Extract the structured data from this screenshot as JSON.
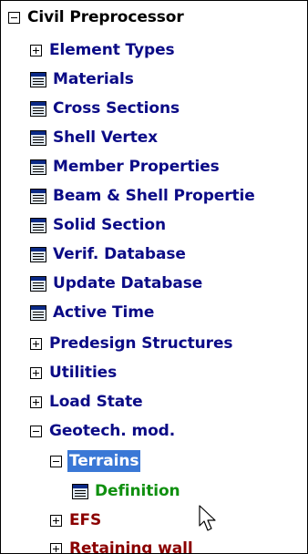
{
  "tree": {
    "root": {
      "label": "Civil Preprocessor",
      "state": "expanded"
    },
    "items": [
      {
        "label": "Element Types",
        "kind": "folder",
        "state": "collapsed",
        "color": "#0b0b86"
      },
      {
        "label": "Materials",
        "kind": "form",
        "color": "#0b0b86"
      },
      {
        "label": "Cross Sections",
        "kind": "form",
        "color": "#0b0b86"
      },
      {
        "label": "Shell Vertex",
        "kind": "form",
        "color": "#0b0b86"
      },
      {
        "label": "Member Properties",
        "kind": "form",
        "color": "#0b0b86"
      },
      {
        "label": "Beam & Shell Propertie",
        "kind": "form",
        "color": "#0b0b86"
      },
      {
        "label": "Solid Section",
        "kind": "form",
        "color": "#0b0b86"
      },
      {
        "label": "Verif. Database",
        "kind": "form",
        "color": "#0b0b86"
      },
      {
        "label": "Update Database",
        "kind": "form",
        "color": "#0b0b86"
      },
      {
        "label": "Active Time",
        "kind": "form",
        "color": "#0b0b86"
      },
      {
        "label": "Predesign Structures",
        "kind": "folder",
        "state": "collapsed",
        "color": "#0b0b86"
      },
      {
        "label": "Utilities",
        "kind": "folder",
        "state": "collapsed",
        "color": "#0b0b86"
      },
      {
        "label": "Load State",
        "kind": "folder",
        "state": "collapsed",
        "color": "#0b0b86"
      },
      {
        "label": "Geotech. mod.",
        "kind": "folder",
        "state": "expanded",
        "color": "#0b0b86"
      }
    ],
    "geotech_children": [
      {
        "label": "Terrains",
        "kind": "folder",
        "state": "expanded",
        "selected": true
      },
      {
        "label": "Definition",
        "kind": "form",
        "color": "#109010"
      },
      {
        "label": "EFS",
        "kind": "folder",
        "state": "collapsed",
        "color": "#8b0000"
      },
      {
        "label": "Retaining wall",
        "kind": "folder",
        "state": "collapsed",
        "color": "#8b0000"
      }
    ]
  },
  "colors": {
    "selection": "#3a78d6",
    "item_text": "#0b0b86",
    "terrain_child": "#109010",
    "wall_text": "#8b0000"
  },
  "icons": {
    "expanded": "minus-box-icon",
    "collapsed": "plus-box-icon",
    "form": "form-window-icon",
    "pointer": "mouse-pointer-icon"
  }
}
